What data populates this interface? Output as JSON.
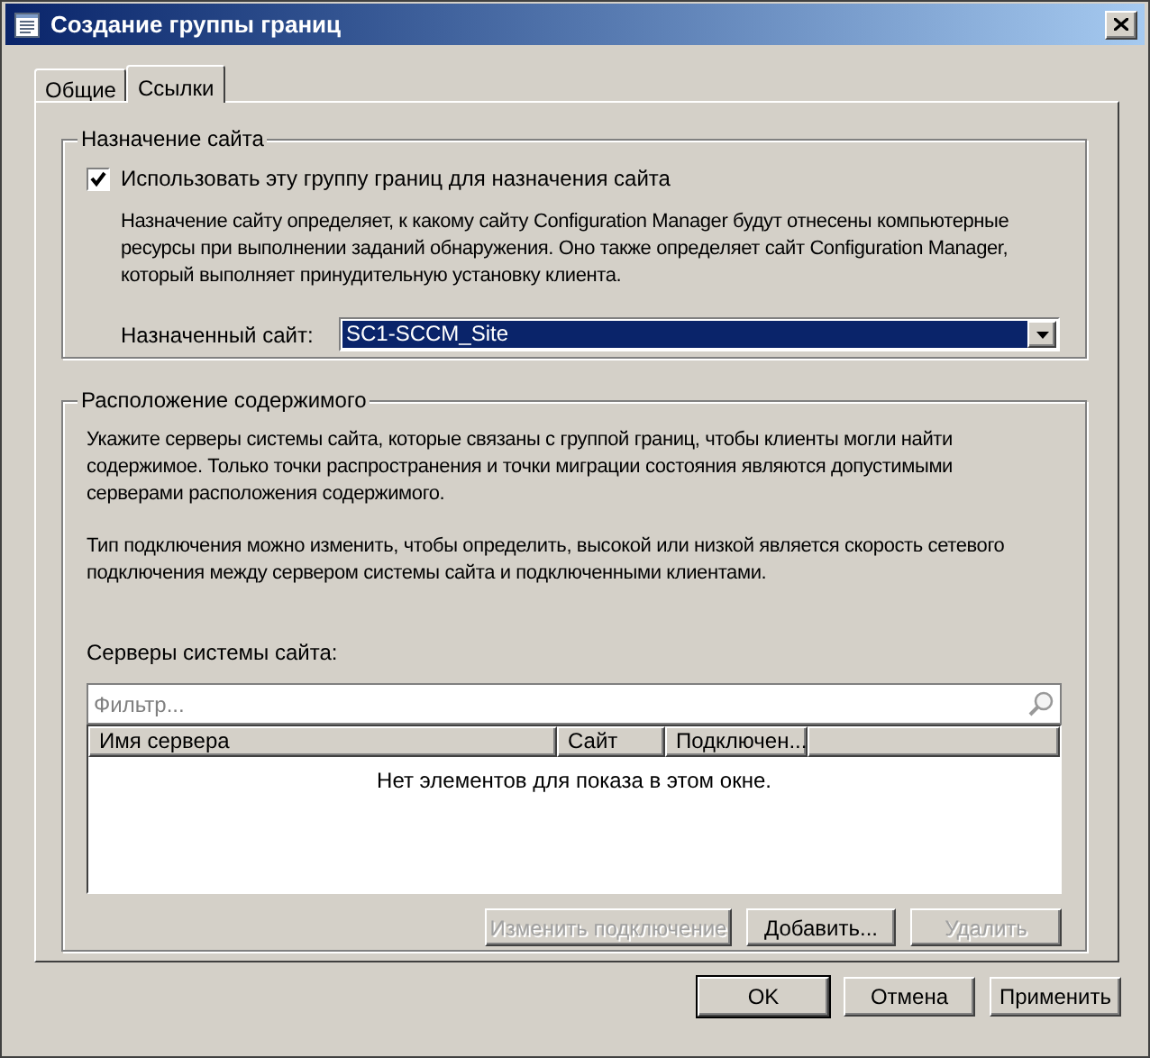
{
  "window": {
    "title": "Создание группы границ"
  },
  "tabs": [
    {
      "label": "Общие",
      "selected": false
    },
    {
      "label": "Ссылки",
      "selected": true
    }
  ],
  "site_assignment": {
    "title": "Назначение сайта",
    "checkbox": {
      "label": "Использовать эту группу границ для назначения сайта",
      "checked": true
    },
    "description": "Назначение сайту определяет, к какому сайту Configuration Manager будут отнесены компьютерные ресурсы при выполнении заданий обнаружения. Оно также определяет сайт Configuration Manager, который выполняет принудительную установку клиента.",
    "assigned_site": {
      "label": "Назначенный сайт:",
      "value": "SC1-SCCM_Site"
    }
  },
  "content_location": {
    "title": "Расположение содержимого",
    "description_1": "Укажите серверы системы сайта, которые связаны с группой границ, чтобы клиенты могли найти содержимое. Только точки распространения и точки миграции состояния являются допустимыми серверами расположения содержимого.",
    "description_2": "Тип подключения можно изменить, чтобы определить, высокой или низкой является скорость сетевого подключения между сервером системы сайта и подключенными клиентами.",
    "servers_label": "Серверы системы сайта:",
    "filter": {
      "placeholder": "Фильтр..."
    },
    "table": {
      "columns": [
        "Имя сервера",
        "Сайт",
        "Подключен..."
      ],
      "empty_text": "Нет элементов для показа в этом окне."
    },
    "buttons": [
      {
        "label": "Изменить подключение",
        "disabled": true
      },
      {
        "label": "Добавить...",
        "disabled": false
      },
      {
        "label": "Удалить",
        "disabled": true
      }
    ]
  },
  "buttons": [
    {
      "label": "OK",
      "default": true
    },
    {
      "label": "Отмена",
      "default": false
    },
    {
      "label": "Применить",
      "default": false
    }
  ]
}
